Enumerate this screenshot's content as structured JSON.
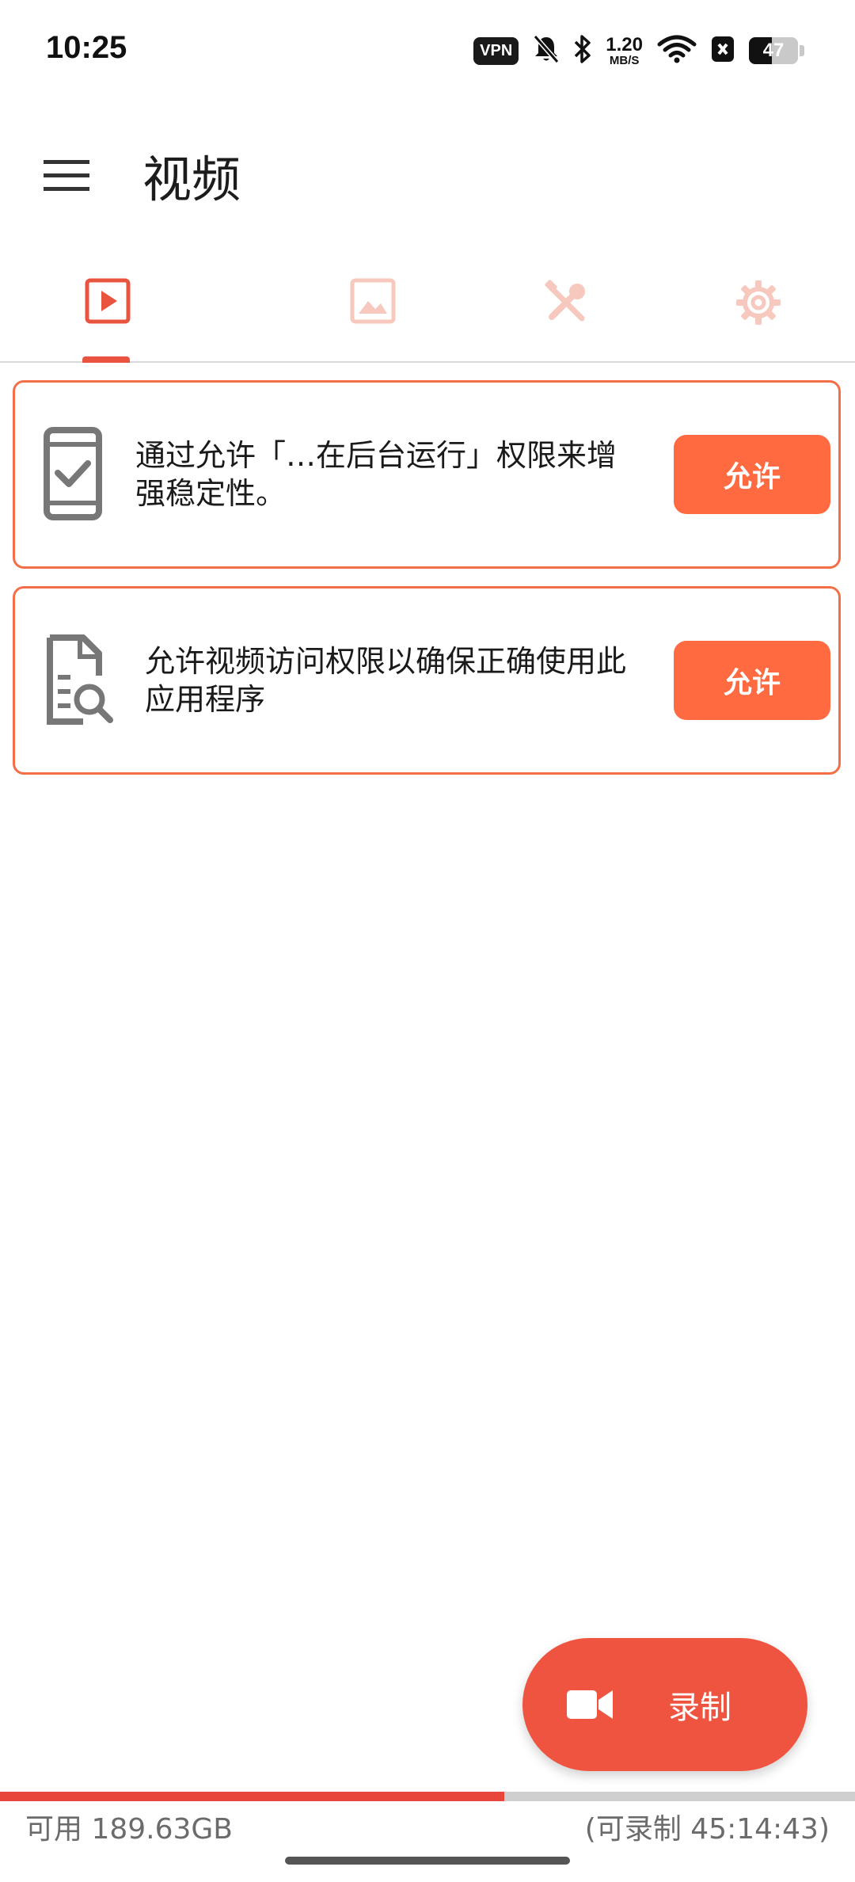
{
  "status_bar": {
    "time": "10:25",
    "vpn_label": "VPN",
    "net_speed_value": "1.20",
    "net_speed_unit": "MB/S",
    "battery_level": "47",
    "battery_fraction": 0.47
  },
  "app_bar": {
    "title": "视频",
    "menu_icon": "menu-icon"
  },
  "tabs": [
    {
      "icon": "video-play-icon",
      "selected": true
    },
    {
      "icon": "image-icon",
      "selected": false
    },
    {
      "icon": "tools-icon",
      "selected": false
    },
    {
      "icon": "settings-gear-icon",
      "selected": false
    }
  ],
  "cards": [
    {
      "icon": "phone-check-icon",
      "message": "通过允许「…在后台运行」权限来增强稳定性。",
      "button_label": "允许"
    },
    {
      "icon": "document-search-icon",
      "message": "允许视频访问权限以确保正确使用此应用程序",
      "button_label": "允许"
    }
  ],
  "fab": {
    "icon": "video-camera-icon",
    "label": "录制"
  },
  "storage": {
    "available_text": "可用 189.63GB",
    "remaining_text": "(可录制 45:14:43)",
    "used_fraction": 0.59
  },
  "colors": {
    "accent": "#e8543f",
    "button": "#ff6a40",
    "card_border": "#f46e48",
    "fab": "#ef5440"
  }
}
